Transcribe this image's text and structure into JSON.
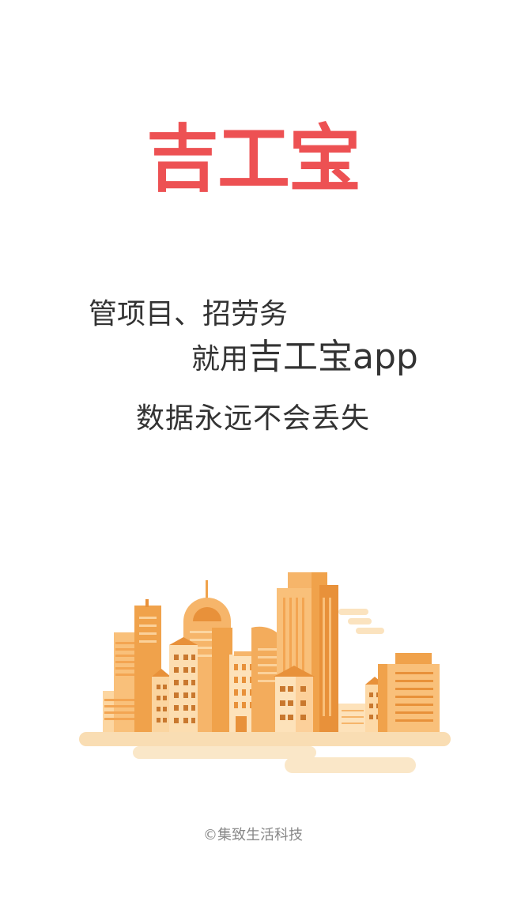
{
  "logo": {
    "text": "吉工宝",
    "color": "#ED5153"
  },
  "slogan": {
    "line1": "管项目、招劳务",
    "line2_prefix": "就用",
    "line2_main": "吉工宝app"
  },
  "tagline": "数据永远不会丢失",
  "illustration": {
    "name": "city-skyline"
  },
  "footer": {
    "copyright": "©集致生活科技"
  }
}
